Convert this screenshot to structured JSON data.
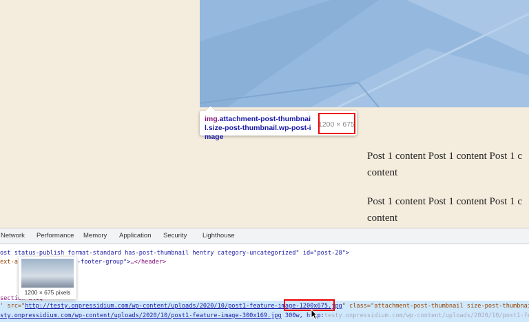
{
  "page": {
    "paragraphs": [
      {
        "line1": "Post 1 content Post 1 content Post 1 c",
        "line2": "content"
      },
      {
        "line1": "Post 1 content Post 1 content Post 1 c",
        "line2": "content"
      }
    ]
  },
  "inspector_tooltip": {
    "tag": "img",
    "selector_rest": ".attachment-post-thumbnail.size-post-thumbnail.wp-post-image",
    "size": "1200 × 675"
  },
  "devtools": {
    "tabs": [
      "Network",
      "Performance",
      "Memory",
      "Application",
      "Security",
      "Lighthouse"
    ],
    "code": {
      "line1": "ost status-publish format-standard has-post-thumbnail hentry category-uncategorized\" id=\"post-28\">",
      "line2_a": "ext-a",
      "line2_b": "-footer-group\">",
      "line2_c": "…</header>",
      "line3": "section alig",
      "src_attr": "' src=\"",
      "src_url": "http://testy.onpressidium.com/wp-content/uploads/2020/10/post1-feature-image-1200x675.jpg",
      "after_src": "\" class=\"attachment-post-thumbnail size-post-thumbnail wp-",
      "srcset_url": "sty.onpressidium.com/wp-content/uploads/2020/10/post1-feature-image-300x169.jpg",
      "srcset_tail": " 300w, http:",
      "srcset_ghost": "testy.onpressidium.com/wp-content/uploads/2020/10/post1-featu"
    },
    "thumbnail_caption": "1200 × 675 pixels"
  },
  "colors": {
    "page_background": "#f4ecdc",
    "hero_image": "#95b9de",
    "highlight_red": "#e00000",
    "selected_row": "#cfe8fc"
  }
}
